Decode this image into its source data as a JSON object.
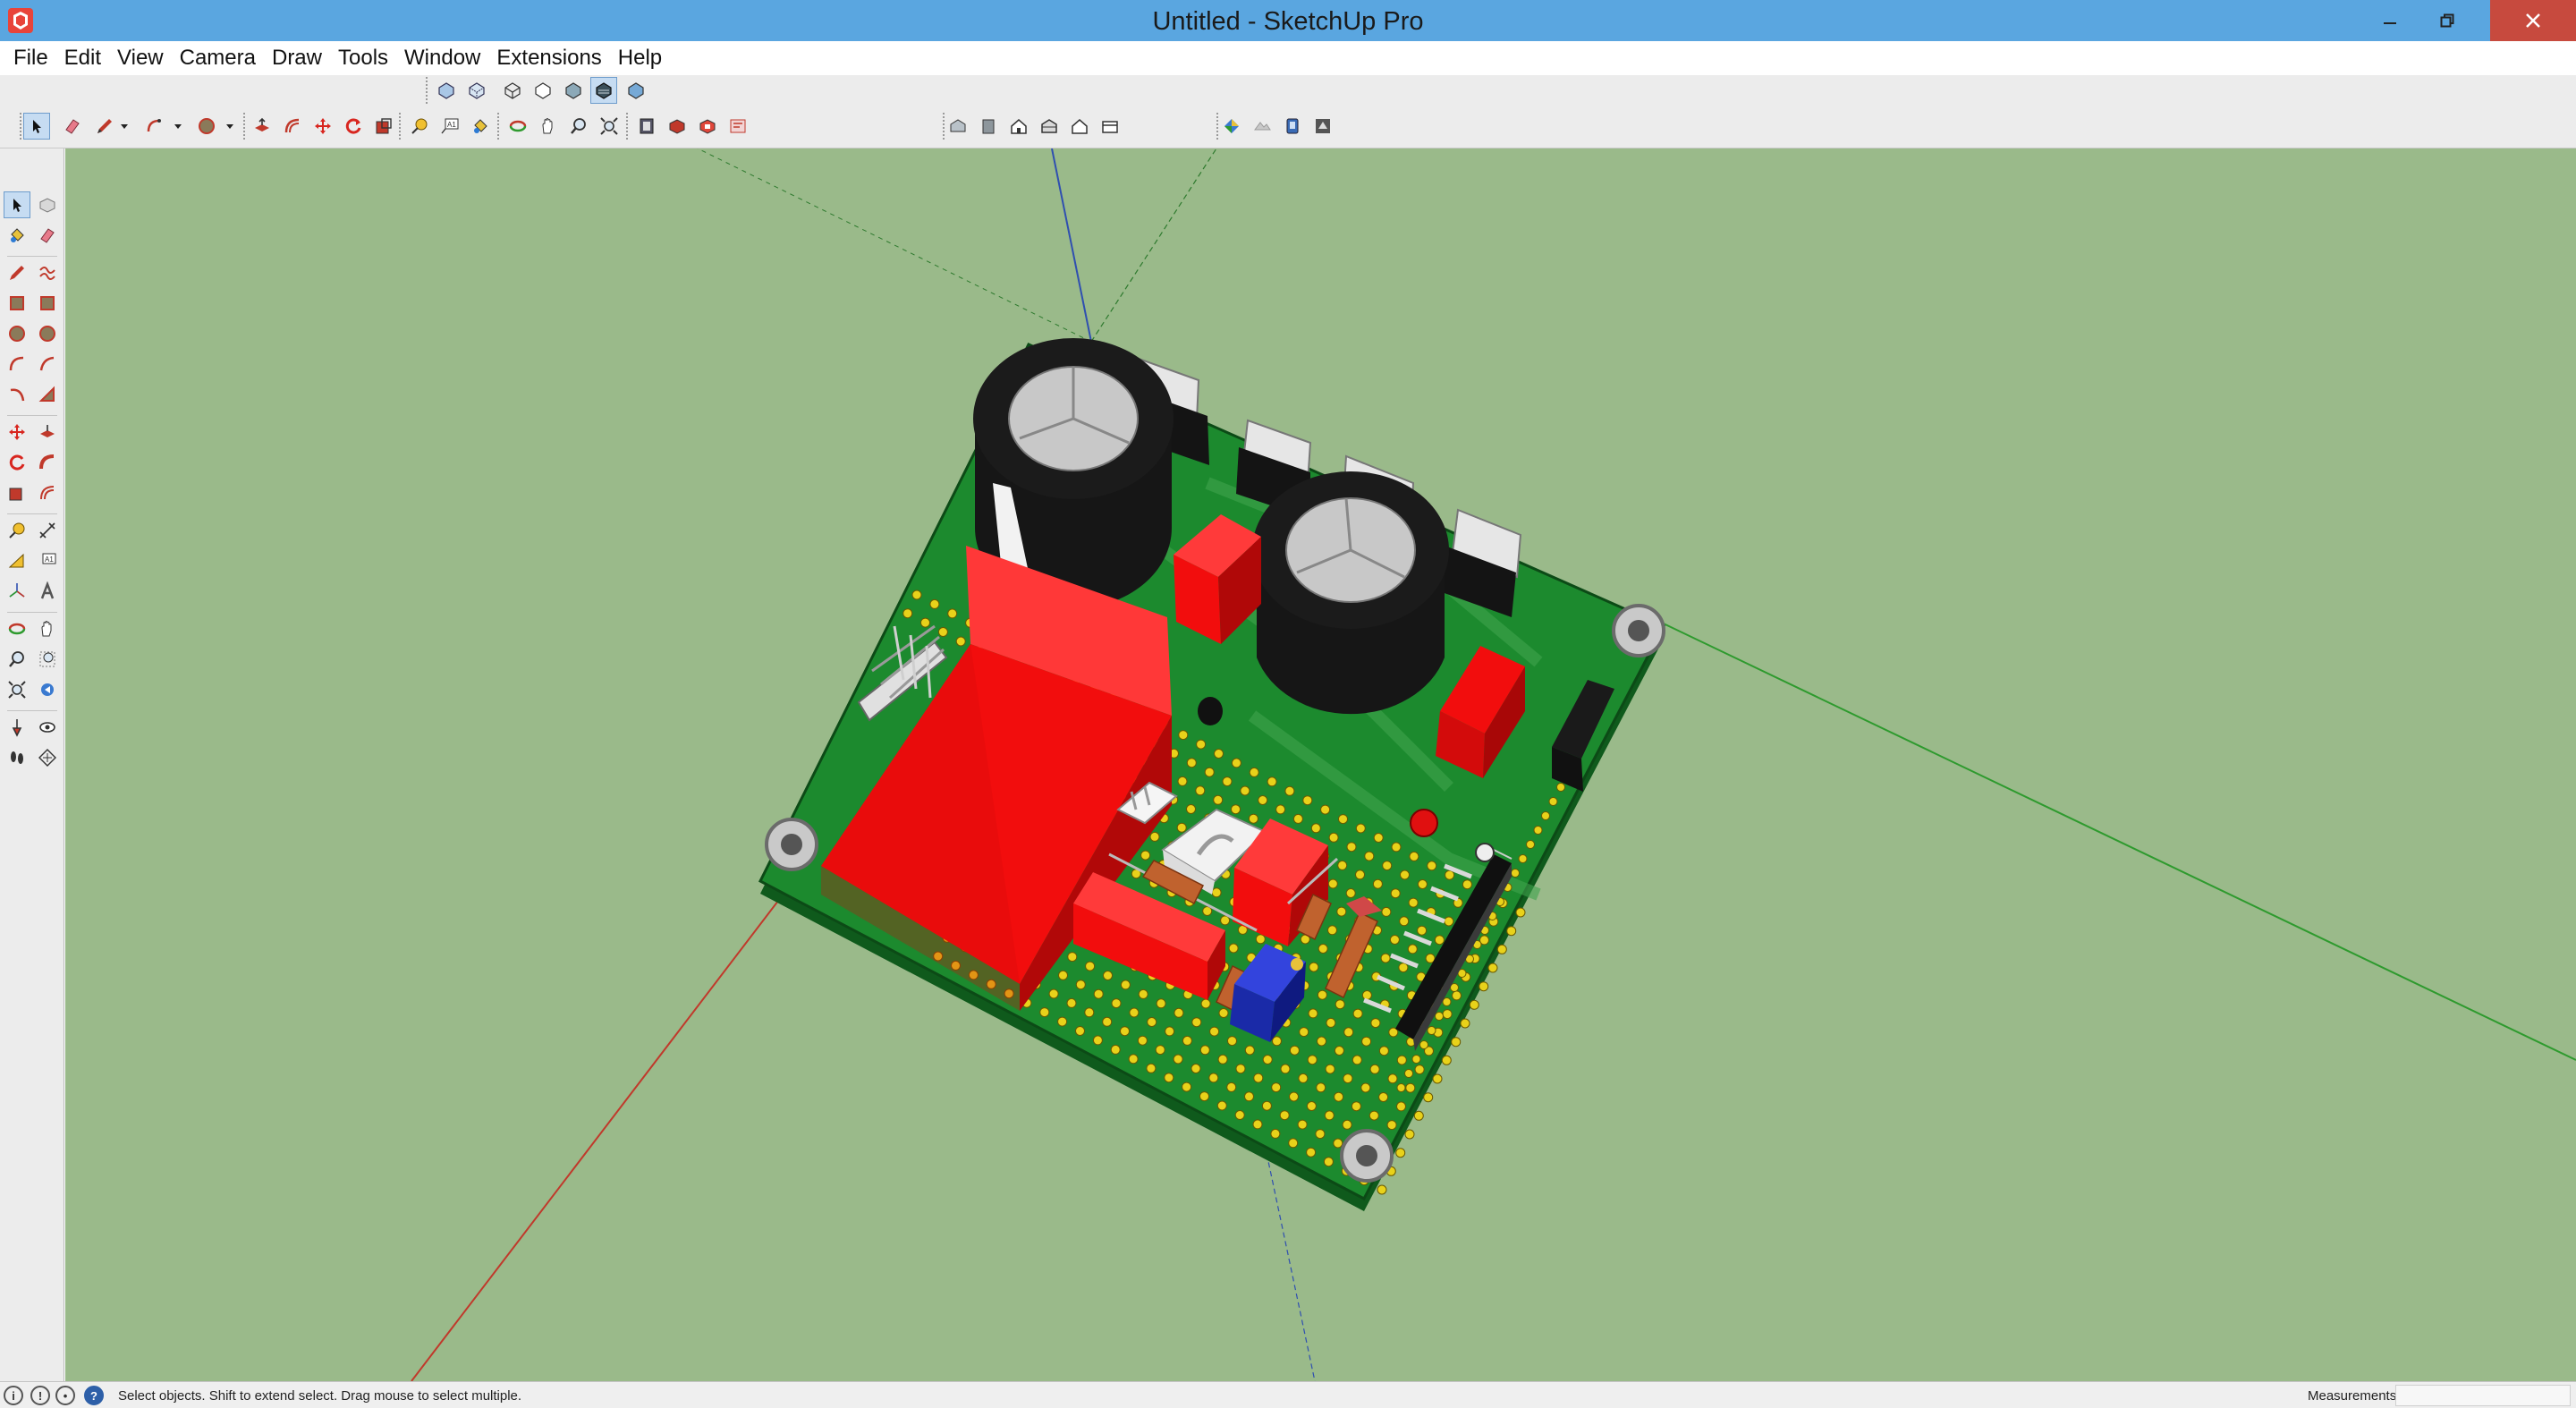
{
  "window": {
    "title": "Untitled - SketchUp Pro"
  },
  "menu": [
    {
      "label": "File"
    },
    {
      "label": "Edit"
    },
    {
      "label": "View"
    },
    {
      "label": "Camera"
    },
    {
      "label": "Draw"
    },
    {
      "label": "Tools"
    },
    {
      "label": "Window"
    },
    {
      "label": "Extensions"
    },
    {
      "label": "Help"
    }
  ],
  "toolbars": {
    "views": [
      "iso-view-icon",
      "top-view-icon",
      "front-view-icon",
      "right-view-icon",
      "back-view-icon",
      "left-view-icon",
      "xray-icon"
    ],
    "styles": [
      "xray-style-icon",
      "back-edges-icon",
      "wireframe-icon",
      "hidden-line-icon",
      "shaded-icon",
      "shaded-textures-icon",
      "monochrome-icon"
    ],
    "main": [
      "select-icon",
      "eraser-icon",
      "pencil-icon",
      "arc-icon",
      "shape-icon",
      "push-pull-icon",
      "offset-icon",
      "move-icon",
      "rotate-icon",
      "scale-icon",
      "tape-measure-icon",
      "text-icon",
      "paint-bucket-icon",
      "orbit-icon",
      "pan-icon",
      "zoom-icon",
      "zoom-extents-icon",
      "warehouse-icon",
      "extension-warehouse-icon",
      "layout-icon",
      "send-to-layout-icon"
    ],
    "warehouse": [
      "warehouse-models-icon",
      "share-model-icon",
      "house-icon",
      "building-icon",
      "roof-icon",
      "store-icon"
    ],
    "extra": [
      "add-location-icon",
      "toggle-terrain-icon",
      "photo-texture-icon",
      "preview-google-earth-icon"
    ]
  },
  "status": {
    "hint": "Select objects. Shift to extend select. Drag mouse to select multiple.",
    "measurements_label": "Measurements",
    "measurements_value": ""
  },
  "colors": {
    "titlebar": "#5aa6e0",
    "close": "#c74a3e",
    "viewport_bg": "#9aba8a",
    "pcb_green": "#1c8a2e",
    "component_red": "#f20d0d",
    "axis_red": "#c0392b",
    "axis_green": "#2e9a2e",
    "axis_blue": "#2f4fb0"
  }
}
